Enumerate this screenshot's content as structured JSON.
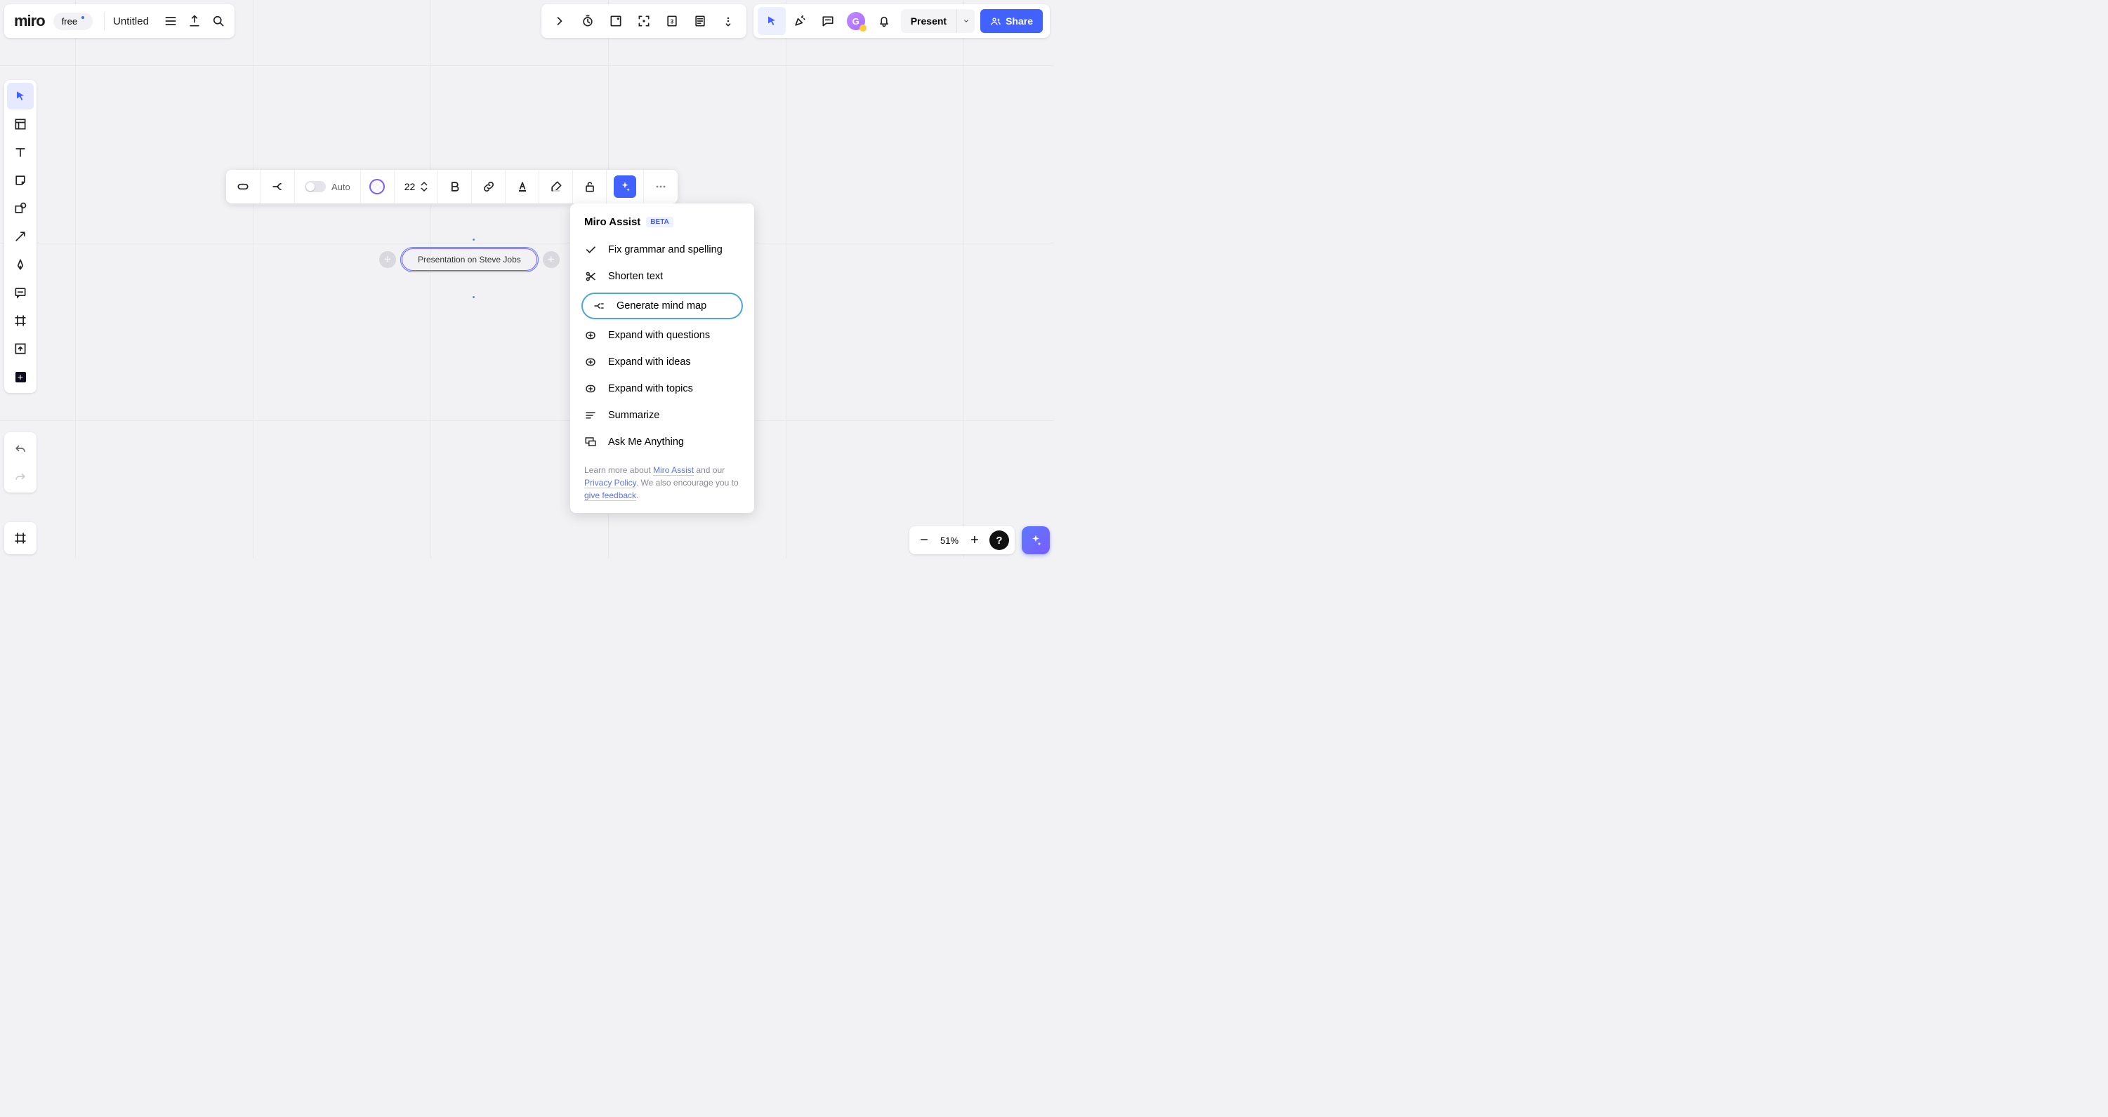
{
  "header": {
    "logo": "miro",
    "plan": "free",
    "title": "Untitled"
  },
  "contextToolbar": {
    "auto": "Auto",
    "fontSize": "22"
  },
  "node": {
    "text": "Presentation on Steve Jobs"
  },
  "assist": {
    "title": "Miro Assist",
    "beta": "BETA",
    "items": {
      "fix": "Fix grammar and spelling",
      "shorten": "Shorten text",
      "mindmap": "Generate mind map",
      "questions": "Expand with questions",
      "ideas": "Expand with ideas",
      "topics": "Expand with topics",
      "summarize": "Summarize",
      "ask": "Ask Me Anything"
    },
    "footer": {
      "pre": "Learn more about ",
      "link1": "Miro Assist",
      "mid1": " and our ",
      "link2": "Privacy Policy",
      "mid2": ". We also encourage you to ",
      "link3": "give feedback",
      "post": "."
    }
  },
  "topRight": {
    "avatarInitial": "G",
    "present": "Present",
    "share": "Share"
  },
  "zoom": {
    "value": "51%"
  },
  "help": "?"
}
